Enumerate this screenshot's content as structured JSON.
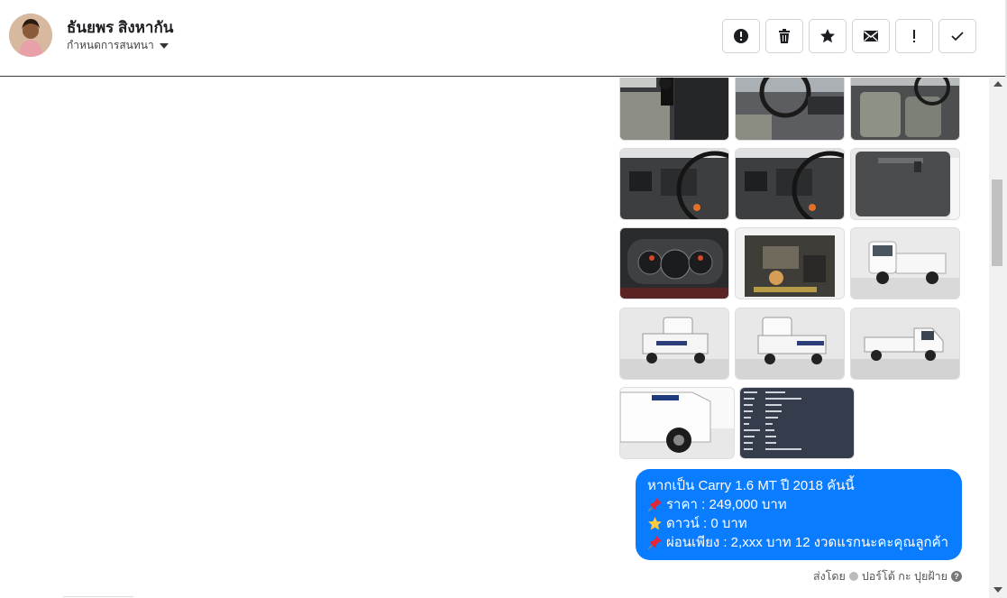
{
  "header": {
    "name": "ธันยพร สิงหากัน",
    "subtitle": "กำหนดการสนทนา",
    "actions": [
      {
        "icon": "alert-circle-icon",
        "name": "report-button"
      },
      {
        "icon": "trash-icon",
        "name": "delete-button"
      },
      {
        "icon": "star-icon",
        "name": "star-button"
      },
      {
        "icon": "mail-icon",
        "name": "mark-unread-button"
      },
      {
        "icon": "exclamation-icon",
        "name": "spam-button"
      },
      {
        "icon": "check-icon",
        "name": "done-button"
      }
    ]
  },
  "images": [
    {
      "desc": "gear-shifter-interior"
    },
    {
      "desc": "steering-wheel-dashboard"
    },
    {
      "desc": "seats-interior"
    },
    {
      "desc": "dashboard-vents"
    },
    {
      "desc": "dashboard-vents-2"
    },
    {
      "desc": "door-panel"
    },
    {
      "desc": "instrument-cluster"
    },
    {
      "desc": "engine-bay"
    },
    {
      "desc": "truck-front-right"
    },
    {
      "desc": "truck-rear-left"
    },
    {
      "desc": "truck-rear"
    },
    {
      "desc": "truck-side"
    },
    {
      "desc": "truck-front-close"
    },
    {
      "desc": "spec-sheet"
    }
  ],
  "message": {
    "line1": "หากเป็น Carry 1.6 MT  ปี 2018 คันนี้",
    "line2": "ราคา : 249,000 บาท",
    "line3": "ดาวน์ : 0 บาท",
    "line4": "ผ่อนเพียง : 2,xxx บาท 12 งวดแรกนะคะคุณลูกค้า"
  },
  "sent_by": {
    "label": "ส่งโดย",
    "sender": "ปอร์โต้ กะ ปุยฝ้าย"
  },
  "colors": {
    "bubble": "#0a7cff",
    "header_border": "#3a3a3a"
  }
}
